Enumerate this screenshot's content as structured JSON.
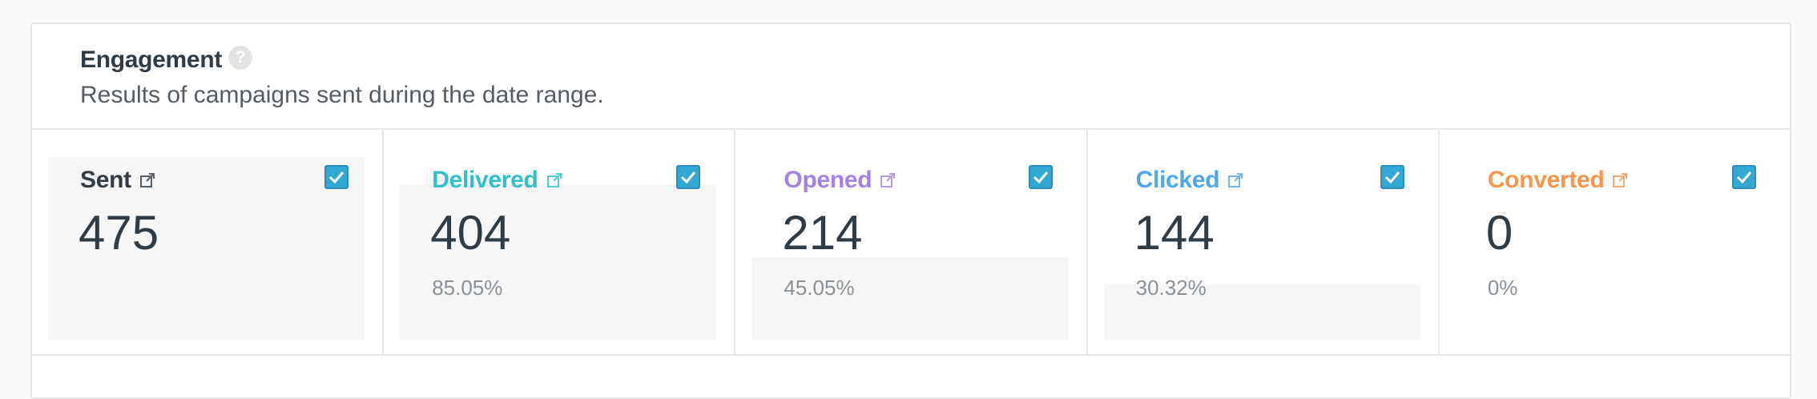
{
  "header": {
    "title": "Engagement",
    "help_icon": "question-mark-icon",
    "subtitle": "Results of campaigns sent during the date range."
  },
  "metrics": [
    {
      "label": "Sent",
      "value": "475",
      "percent": "",
      "color": "#2f3b45",
      "checked": true,
      "fill_fraction": 1.0
    },
    {
      "label": "Delivered",
      "value": "404",
      "percent": "85.05%",
      "color": "#2fc1c9",
      "checked": true,
      "fill_fraction": 0.8505
    },
    {
      "label": "Opened",
      "value": "214",
      "percent": "45.05%",
      "color": "#a582e0",
      "checked": true,
      "fill_fraction": 0.4505
    },
    {
      "label": "Clicked",
      "value": "144",
      "percent": "30.32%",
      "color": "#4fa7e6",
      "checked": true,
      "fill_fraction": 0.3032
    },
    {
      "label": "Converted",
      "value": "0",
      "percent": "0%",
      "color": "#f7964d",
      "checked": true,
      "fill_fraction": 0
    }
  ],
  "icons": {
    "external_link": "external-link-icon",
    "checkbox": "checkmark-icon"
  },
  "colors": {
    "checkbox_bg": "#34a8d4",
    "fill_bg": "#f6f6f6"
  }
}
